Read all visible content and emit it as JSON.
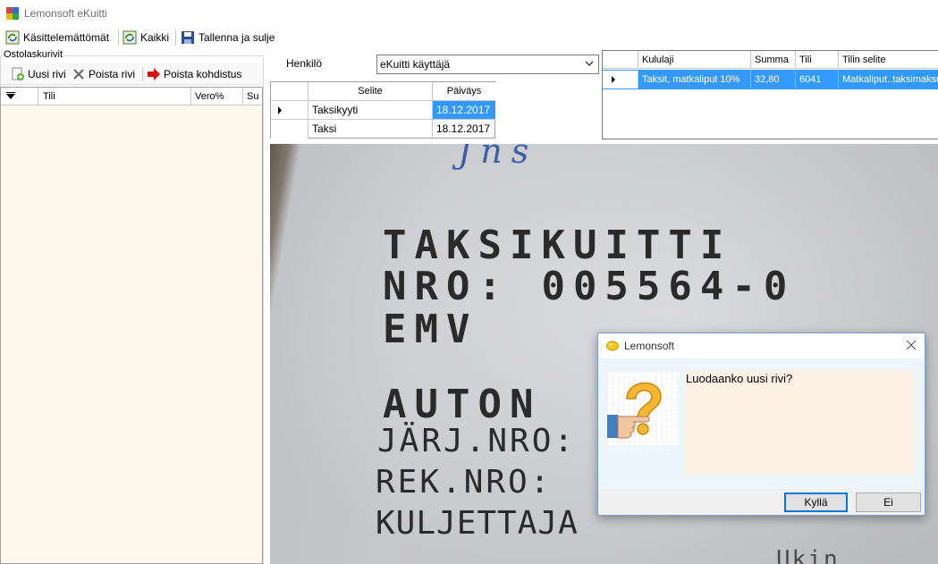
{
  "window": {
    "title": "Lemonsoft eKuitti"
  },
  "toolbar": {
    "unprocessed_label": "Käsittelemättömät",
    "all_label": "Kaikki",
    "save_close_label": "Tallenna ja sulje"
  },
  "left_panel": {
    "group_label": "Ostolaskurivit",
    "new_row_label": "Uusi rivi",
    "delete_row_label": "Poista rivi",
    "delete_allocation_label": "Poista kohdistus",
    "columns": [
      "Tili",
      "Vero%",
      "Su"
    ]
  },
  "person": {
    "label": "Henkilö",
    "selected": "eKuitti käyttäjä"
  },
  "receipts": {
    "columns": [
      "Selite",
      "Päiväys"
    ],
    "rows": [
      {
        "description": "Taksikyyti",
        "date": "18.12.2017"
      },
      {
        "description": "Taksi",
        "date": "18.12.2017"
      }
    ]
  },
  "accounts": {
    "columns": [
      "Kululaji",
      "Summa",
      "Tili",
      "Tilin selite"
    ],
    "rows": [
      {
        "type": "Taksit, matkaliput 10%",
        "amount": "32,80",
        "account": "6041",
        "account_desc": "Matkaliput..taksimaksu"
      }
    ]
  },
  "receipt_image": {
    "lines": [
      "Jns",
      "TAKSIKUITTI",
      "NRO: 005564-0",
      "EMV",
      "AUTON",
      "JÄRJ.NRO:",
      "REK.NRO:",
      "KULJETTAJA",
      "Ukin"
    ]
  },
  "dialog": {
    "title": "Lemonsoft",
    "message": "Luodaanko uusi rivi?",
    "yes_label": "Kyllä",
    "no_label": "Ei"
  },
  "colors": {
    "selection": "#3399ff",
    "dialog_message_bg": "#fcf1e4",
    "grid_bg": "#fdf8ec"
  }
}
